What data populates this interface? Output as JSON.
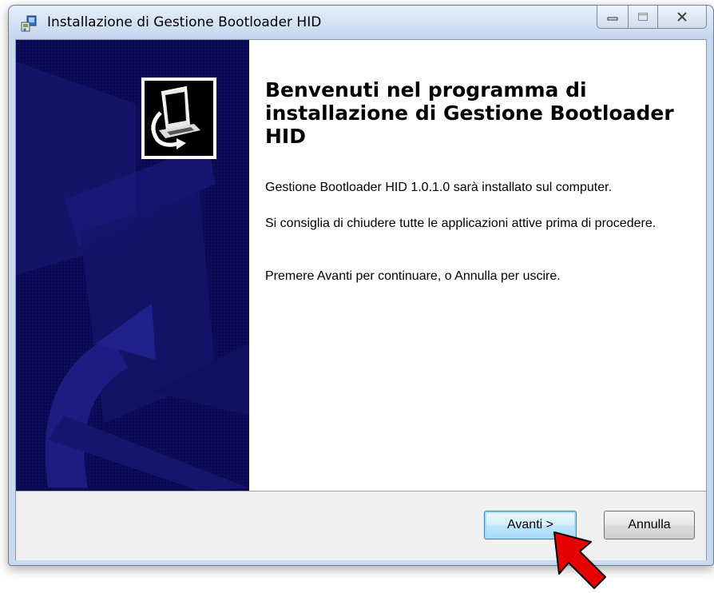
{
  "window": {
    "title": "Installazione di Gestione Bootloader HID"
  },
  "welcome": {
    "heading": "Benvenuti nel programma di installazione di Gestione Bootloader HID",
    "line1": "Gestione Bootloader HID 1.0.1.0 sarà installato sul computer.",
    "line2": "Si consiglia di chiudere tutte le applicazioni attive prima di procedere.",
    "line3": "Premere Avanti per continuare, o Annulla per uscire."
  },
  "buttons": {
    "next": "Avanti >",
    "cancel": "Annulla"
  },
  "colors": {
    "side_panel": "#0a0a55",
    "pointer_arrow": "#e60000",
    "default_button_border": "#3c7fb1"
  },
  "icons": {
    "app": "installer-icon",
    "logo": "computer-install-logo-icon",
    "minimize": "minimize-icon",
    "maximize": "maximize-icon",
    "close": "close-icon",
    "pointer": "red-arrow-pointer-icon"
  }
}
